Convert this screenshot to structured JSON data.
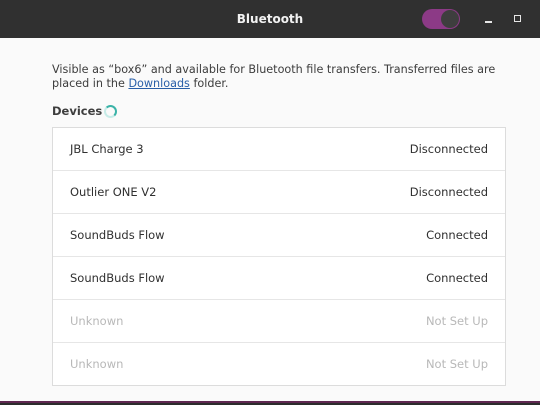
{
  "window": {
    "title": "Bluetooth",
    "bluetooth_enabled": true
  },
  "description": {
    "prefix": "Visible as “box6” and available for Bluetooth file transfers. Transferred files are placed in the ",
    "link": "Downloads",
    "suffix": " folder."
  },
  "devices": {
    "heading": "Devices",
    "items": [
      {
        "name": "JBL Charge 3",
        "status": "Disconnected"
      },
      {
        "name": "Outlier ONE V2",
        "status": "Disconnected"
      },
      {
        "name": "SoundBuds Flow",
        "status": "Connected"
      },
      {
        "name": "SoundBuds Flow",
        "status": "Connected"
      },
      {
        "name": "Unknown",
        "status": "Not Set Up"
      },
      {
        "name": "Unknown",
        "status": "Not Set Up"
      }
    ]
  },
  "colors": {
    "accent": "#8c3a86",
    "titlebar": "#303030",
    "link": "#2a5fa8",
    "spinner": "#3bb3a8"
  },
  "icons": {
    "minimize": "minimize-icon",
    "maximize": "maximize-icon",
    "spinner": "loading-spinner-icon"
  }
}
